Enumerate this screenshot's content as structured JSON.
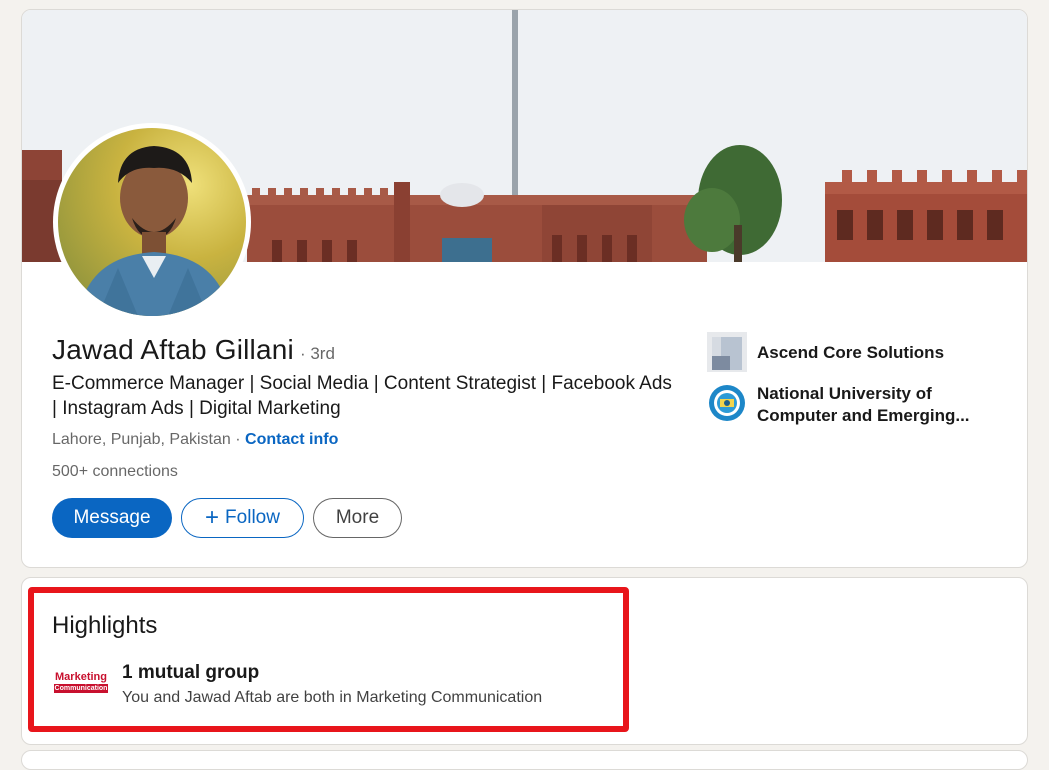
{
  "profile": {
    "name": "Jawad Aftab Gillani",
    "degree": "· 3rd",
    "headline": "E-Commerce Manager | Social Media | Content Strategist | Facebook Ads | Instagram Ads | Digital Marketing",
    "location": "Lahore, Punjab, Pakistan",
    "location_separator": "·",
    "contact_info_label": "Contact info",
    "connections": "500+ connections",
    "actions": {
      "message_label": "Message",
      "follow_label": "Follow",
      "follow_icon": "plus-icon",
      "more_label": "More"
    },
    "organizations": [
      {
        "name": "Ascend Core Solutions",
        "logo_icon": "company-logo-icon"
      },
      {
        "name": "National University of Computer and Emerging...",
        "logo_icon": "university-logo-icon"
      }
    ]
  },
  "highlights": {
    "title": "Highlights",
    "item": {
      "heading": "1 mutual group",
      "description": "You and Jawad Aftab are both in Marketing Communication",
      "logo_text_top": "Marketing",
      "logo_text_bottom": "Communication"
    }
  },
  "annotation": {
    "color": "#e8151b"
  },
  "colors": {
    "accent": "#0a66c2",
    "page_background": "#f4f2ee"
  }
}
